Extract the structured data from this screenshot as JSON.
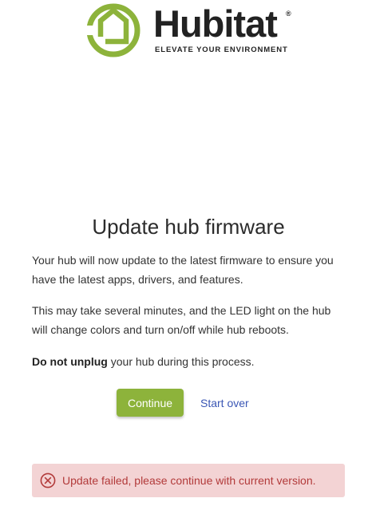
{
  "logo": {
    "wordmark": "Hubitat",
    "registered": "®",
    "tagline": "ELEVATE YOUR ENVIRONMENT",
    "brand_color": "#8db33b"
  },
  "main": {
    "title": "Update hub firmware",
    "paragraph1": "Your hub will now update to the latest firmware to ensure you have the latest apps, drivers, and features.",
    "paragraph2": "This may take several minutes, and the LED light on the hub will change colors and turn on/off while hub reboots.",
    "warning_bold": "Do not unplug",
    "warning_rest": " your hub during this process."
  },
  "actions": {
    "continue_label": "Continue",
    "start_over_label": "Start over"
  },
  "alert": {
    "icon": "error-circle-x-icon",
    "message": "Update failed, please continue with current version.",
    "color": "#b23a3a",
    "background": "#f3d3d4"
  }
}
